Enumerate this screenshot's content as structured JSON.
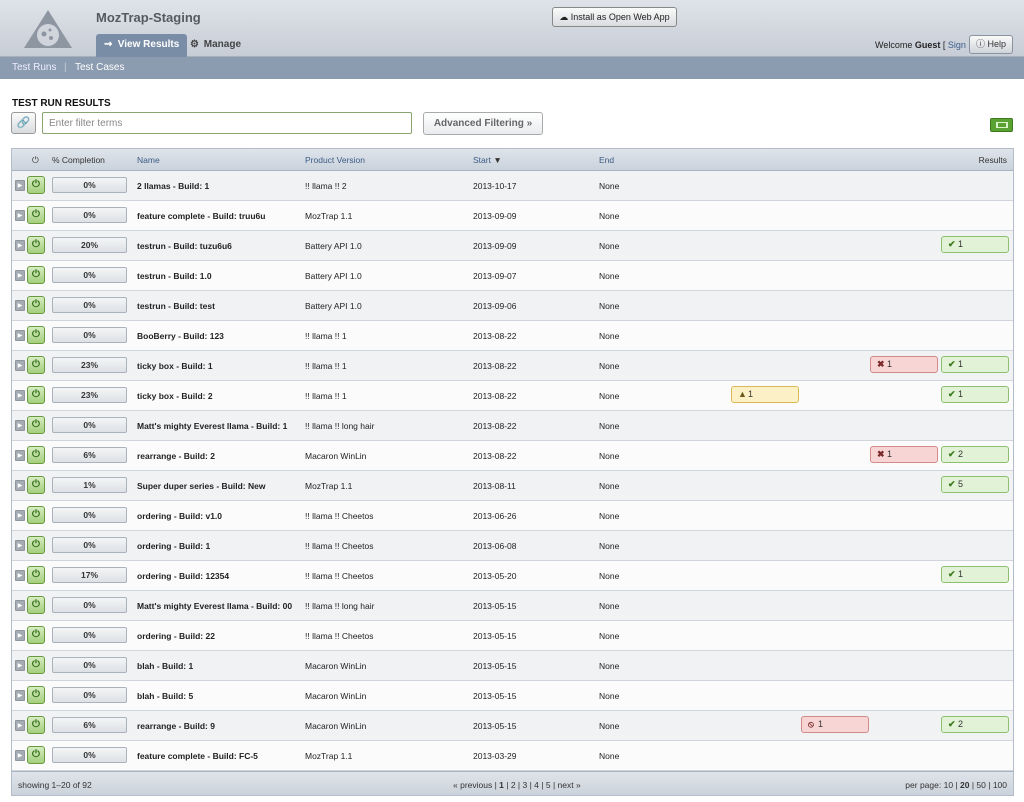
{
  "header": {
    "app_title": "MozTrap-Staging",
    "nav_tabs": [
      {
        "label": "View Results",
        "icon": "results-icon",
        "active": true
      },
      {
        "label": "Manage",
        "icon": "gear-icon",
        "active": false
      }
    ],
    "install_button": "Install as Open Web App",
    "welcome_text": "Welcome",
    "welcome_user": "Guest",
    "sign_in": "Sign In",
    "help_button": "Help"
  },
  "subnav": {
    "items": [
      "Test Runs",
      "Test Cases"
    ],
    "separator": "|"
  },
  "page": {
    "title": "TEST RUN RESULTS",
    "filter_placeholder": "Enter filter terms",
    "advanced_filtering": "Advanced Filtering »"
  },
  "table": {
    "columns": {
      "completion": "% Completion",
      "name": "Name",
      "product_version": "Product Version",
      "start": "Start",
      "end": "End",
      "results": "Results"
    },
    "sort_indicator": "▼",
    "rows": [
      {
        "completion": "0%",
        "name": "2 llamas - Build: 1",
        "version": "!! llama !! 2",
        "start": "2013-10-17",
        "end": "None",
        "results": {}
      },
      {
        "completion": "0%",
        "name": "feature complete - Build: truu6u",
        "version": "MozTrap 1.1",
        "start": "2013-09-09",
        "end": "None",
        "results": {}
      },
      {
        "completion": "20%",
        "name": "testrun - Build: tuzu6u6",
        "version": "Battery API 1.0",
        "start": "2013-09-09",
        "end": "None",
        "results": {
          "passed": "1"
        }
      },
      {
        "completion": "0%",
        "name": "testrun - Build: 1.0",
        "version": "Battery API 1.0",
        "start": "2013-09-07",
        "end": "None",
        "results": {}
      },
      {
        "completion": "0%",
        "name": "testrun - Build: test",
        "version": "Battery API 1.0",
        "start": "2013-09-06",
        "end": "None",
        "results": {}
      },
      {
        "completion": "0%",
        "name": "BooBerry - Build: 123",
        "version": "!! llama !! 1",
        "start": "2013-08-22",
        "end": "None",
        "results": {}
      },
      {
        "completion": "23%",
        "name": "ticky box - Build: 1",
        "version": "!! llama !! 1",
        "start": "2013-08-22",
        "end": "None",
        "results": {
          "failed": "1",
          "passed": "1"
        }
      },
      {
        "completion": "23%",
        "name": "ticky box - Build: 2",
        "version": "!! llama !! 1",
        "start": "2013-08-22",
        "end": "None",
        "results": {
          "invalid": "1",
          "passed": "1"
        }
      },
      {
        "completion": "0%",
        "name": "Matt's mighty Everest llama - Build: 1",
        "version": "!! llama !! long hair",
        "start": "2013-08-22",
        "end": "None",
        "results": {}
      },
      {
        "completion": "6%",
        "name": "rearrange - Build: 2",
        "version": "Macaron WinLin",
        "start": "2013-08-22",
        "end": "None",
        "results": {
          "failed": "1",
          "passed": "2"
        }
      },
      {
        "completion": "1%",
        "name": "Super duper series - Build: New",
        "version": "MozTrap 1.1",
        "start": "2013-08-11",
        "end": "None",
        "results": {
          "passed": "5"
        }
      },
      {
        "completion": "0%",
        "name": "ordering - Build: v1.0",
        "version": "!! llama !! Cheetos",
        "start": "2013-06-26",
        "end": "None",
        "results": {}
      },
      {
        "completion": "0%",
        "name": "ordering - Build: 1",
        "version": "!! llama !! Cheetos",
        "start": "2013-06-08",
        "end": "None",
        "results": {}
      },
      {
        "completion": "17%",
        "name": "ordering - Build: 12354",
        "version": "!! llama !! Cheetos",
        "start": "2013-05-20",
        "end": "None",
        "results": {
          "passed": "1"
        }
      },
      {
        "completion": "0%",
        "name": "Matt's mighty Everest llama - Build: 00",
        "version": "!! llama !! long hair",
        "start": "2013-05-15",
        "end": "None",
        "results": {}
      },
      {
        "completion": "0%",
        "name": "ordering - Build: 22",
        "version": "!! llama !! Cheetos",
        "start": "2013-05-15",
        "end": "None",
        "results": {}
      },
      {
        "completion": "0%",
        "name": "blah - Build: 1",
        "version": "Macaron WinLin",
        "start": "2013-05-15",
        "end": "None",
        "results": {}
      },
      {
        "completion": "0%",
        "name": "blah - Build: 5",
        "version": "Macaron WinLin",
        "start": "2013-05-15",
        "end": "None",
        "results": {}
      },
      {
        "completion": "6%",
        "name": "rearrange - Build: 9",
        "version": "Macaron WinLin",
        "start": "2013-05-15",
        "end": "None",
        "results": {
          "blocked": "1",
          "passed": "2"
        }
      },
      {
        "completion": "0%",
        "name": "feature complete - Build: FC-5",
        "version": "MozTrap 1.1",
        "start": "2013-03-29",
        "end": "None",
        "results": {}
      }
    ]
  },
  "footer": {
    "showing": "showing 1–20 of 92",
    "pager": {
      "previous": "« previous",
      "pages": [
        "1",
        "2",
        "3",
        "4",
        "5"
      ],
      "current": "1",
      "next": "next »"
    },
    "per_page_label": "per page:",
    "per_page_options": [
      "10",
      "20",
      "50",
      "100"
    ],
    "per_page_current": "20"
  },
  "colors": {
    "header_bg": "#c7cdd6",
    "subnav_bg": "#8b9bb0",
    "active_tab": "#7a8da6",
    "pass": "#e1f2d6",
    "fail": "#f7d5d5",
    "warn": "#fcf1c6",
    "link": "#3c5b86"
  }
}
